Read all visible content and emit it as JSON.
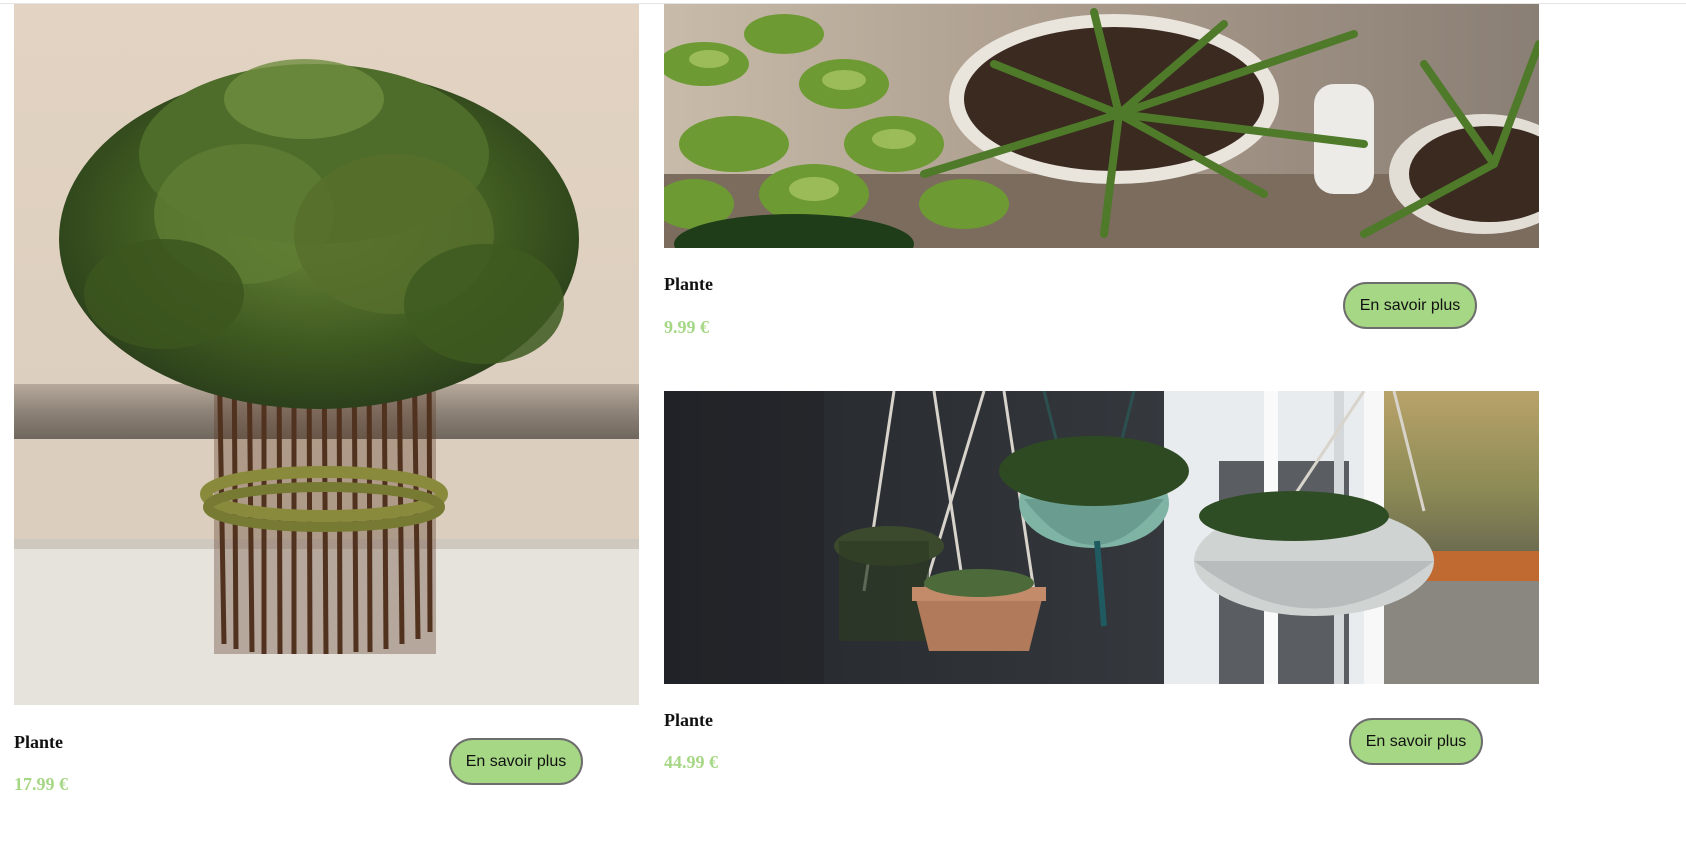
{
  "products": [
    {
      "name": "Plante",
      "price": "17.99 €",
      "button_label": "En savoir plus",
      "image": "boxwood-twig-bundle-photo"
    },
    {
      "name": "Plante",
      "price": "9.99 €",
      "button_label": "En savoir plus",
      "image": "potted-spider-plants-photo"
    },
    {
      "name": "Plante",
      "price": "44.99 €",
      "button_label": "En savoir plus",
      "image": "hanging-macrame-planters-photo"
    }
  ],
  "colors": {
    "accent": "#a6d785",
    "button_border": "#6d6d6d",
    "text": "#111111"
  }
}
